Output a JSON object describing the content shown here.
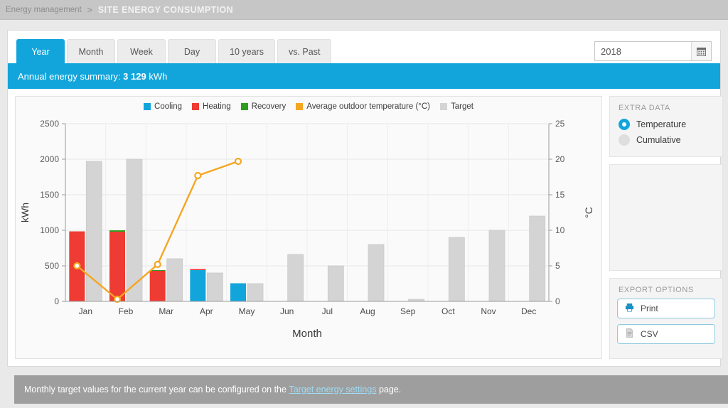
{
  "breadcrumb": {
    "parent": "Energy management",
    "separator": ">",
    "current": "SITE ENERGY CONSUMPTION"
  },
  "tabs": [
    {
      "label": "Year",
      "active": true
    },
    {
      "label": "Month",
      "active": false
    },
    {
      "label": "Week",
      "active": false
    },
    {
      "label": "Day",
      "active": false
    },
    {
      "label": "10 years",
      "active": false
    },
    {
      "label": "vs. Past",
      "active": false
    }
  ],
  "year_picker": {
    "value": "2018",
    "placeholder": "Year",
    "icon": "calendar-icon"
  },
  "summary": {
    "prefix": "Annual energy summary:",
    "value": "3 129",
    "unit": "kWh"
  },
  "extra_data": {
    "title": "EXTRA DATA",
    "options": [
      {
        "label": "Temperature",
        "selected": true
      },
      {
        "label": "Cumulative",
        "selected": false
      }
    ]
  },
  "export_options": {
    "title": "EXPORT OPTIONS",
    "buttons": [
      {
        "label": "Print",
        "icon": "printer-icon"
      },
      {
        "label": "CSV",
        "icon": "document-icon"
      }
    ]
  },
  "footer": {
    "text_before": "Monthly target values for the current year can be configured on the",
    "link": "Target energy settings",
    "text_after": "page."
  },
  "colors": {
    "accent": "#12a5dc",
    "cooling": "#12a5dc",
    "heating": "#ee3b33",
    "recovery": "#2f9e20",
    "temperature": "#f5a623",
    "target": "#d4d4d4",
    "header_bar": "#c6c6c6",
    "footer_bar": "#9e9e9e"
  },
  "chart_data": {
    "type": "bar",
    "title": "",
    "xlabel": "Month",
    "ylabel": "kWh",
    "y2label": "°C",
    "ylim": [
      0,
      2500
    ],
    "y2lim": [
      0,
      25
    ],
    "yticks": [
      0,
      500,
      1000,
      1500,
      2000,
      2500
    ],
    "y2ticks": [
      0,
      5,
      10,
      15,
      20,
      25
    ],
    "grid": true,
    "legend_position": "top",
    "categories": [
      "Jan",
      "Feb",
      "Mar",
      "Apr",
      "May",
      "Jun",
      "Jul",
      "Aug",
      "Sep",
      "Oct",
      "Nov",
      "Dec"
    ],
    "series": [
      {
        "name": "Cooling",
        "color": "#12a5dc",
        "type": "bar-stacked",
        "axis": "left",
        "values": [
          0,
          0,
          0,
          440,
          255,
          0,
          0,
          0,
          0,
          0,
          0,
          0
        ]
      },
      {
        "name": "Heating",
        "color": "#ee3b33",
        "type": "bar-stacked",
        "axis": "left",
        "values": [
          985,
          980,
          435,
          15,
          0,
          0,
          0,
          0,
          0,
          0,
          0,
          0
        ]
      },
      {
        "name": "Recovery",
        "color": "#2f9e20",
        "type": "bar-stacked",
        "axis": "left",
        "values": [
          0,
          20,
          5,
          0,
          0,
          0,
          0,
          0,
          0,
          0,
          0,
          0
        ]
      },
      {
        "name": "Target",
        "color": "#d4d4d4",
        "type": "bar",
        "axis": "left",
        "values": [
          1970,
          2000,
          600,
          400,
          250,
          660,
          500,
          800,
          30,
          900,
          1000,
          1200
        ]
      },
      {
        "name": "Average outdoor temperature (°C)",
        "color": "#f5a623",
        "type": "line",
        "axis": "right",
        "values": [
          5.0,
          0.3,
          5.2,
          17.7,
          19.7,
          null,
          null,
          null,
          null,
          null,
          null,
          null
        ]
      }
    ],
    "legend": [
      {
        "label": "Cooling",
        "color": "#12a5dc"
      },
      {
        "label": "Heating",
        "color": "#ee3b33"
      },
      {
        "label": "Recovery",
        "color": "#2f9e20"
      },
      {
        "label": "Average outdoor temperature (°C)",
        "color": "#f5a623"
      },
      {
        "label": "Target",
        "color": "#d4d4d4"
      }
    ]
  }
}
